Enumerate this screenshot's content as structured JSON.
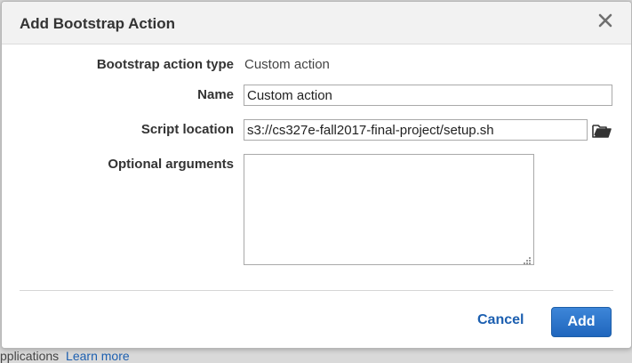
{
  "dialog": {
    "title": "Add Bootstrap Action",
    "close_icon": "close-icon"
  },
  "form": {
    "bootstrap_type": {
      "label": "Bootstrap action type",
      "value": "Custom action"
    },
    "name": {
      "label": "Name",
      "value": "Custom action"
    },
    "script_location": {
      "label": "Script location",
      "value": "s3://cs327e-fall2017-final-project/setup.sh",
      "browse_icon": "folder-open-icon"
    },
    "optional_arguments": {
      "label": "Optional arguments",
      "value": ""
    }
  },
  "footer": {
    "cancel_label": "Cancel",
    "add_label": "Add"
  },
  "backdrop": {
    "partial_text": "pplications",
    "partial_link": "Learn more"
  }
}
